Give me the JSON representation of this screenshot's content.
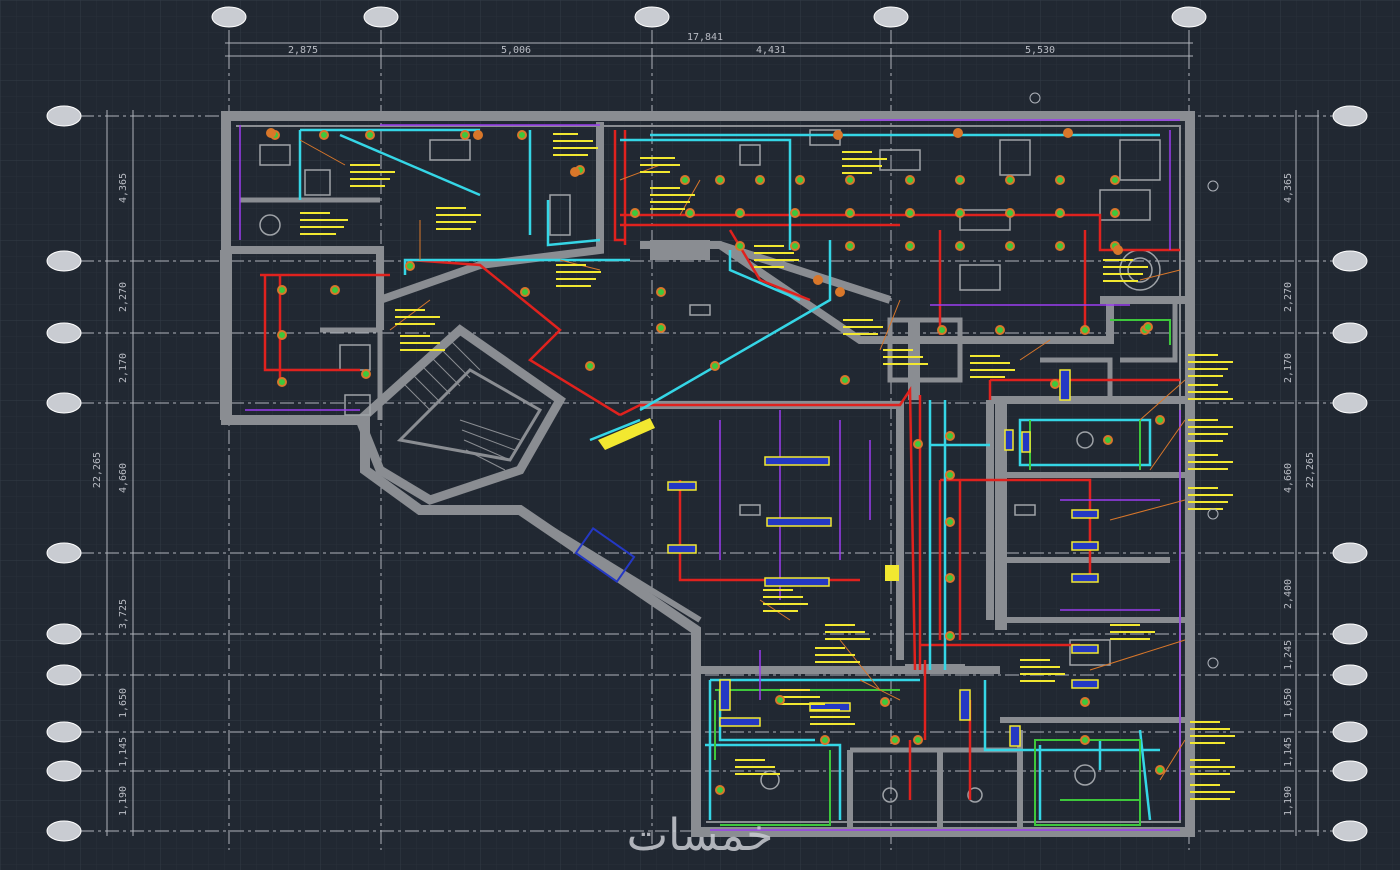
{
  "drawing": {
    "overall_dimension": "17,841",
    "top_dimensions": [
      "2,875",
      "5,006",
      "4,431",
      "5,530"
    ],
    "left_dimensions": [
      "4,365",
      "2,270",
      "2,170",
      "4,660",
      "3,725",
      "1,650",
      "1,145",
      "1,190"
    ],
    "left_total": "22,265",
    "right_dimensions": [
      "4,365",
      "2,270",
      "2,170",
      "4,660",
      "2,400",
      "1,245",
      "1,650",
      "1,145",
      "1,190"
    ],
    "right_total": "22,265"
  },
  "watermark": "خمسات",
  "colors": {
    "background": "#212832",
    "grid": "#2d3540",
    "wall": "#8a8d92",
    "red_pipe": "#e0221e",
    "cyan_pipe": "#35d6e6",
    "yellow_text": "#f2e830",
    "purple": "#9b3cf0",
    "green": "#3ec83c",
    "orange": "#d9772a"
  }
}
